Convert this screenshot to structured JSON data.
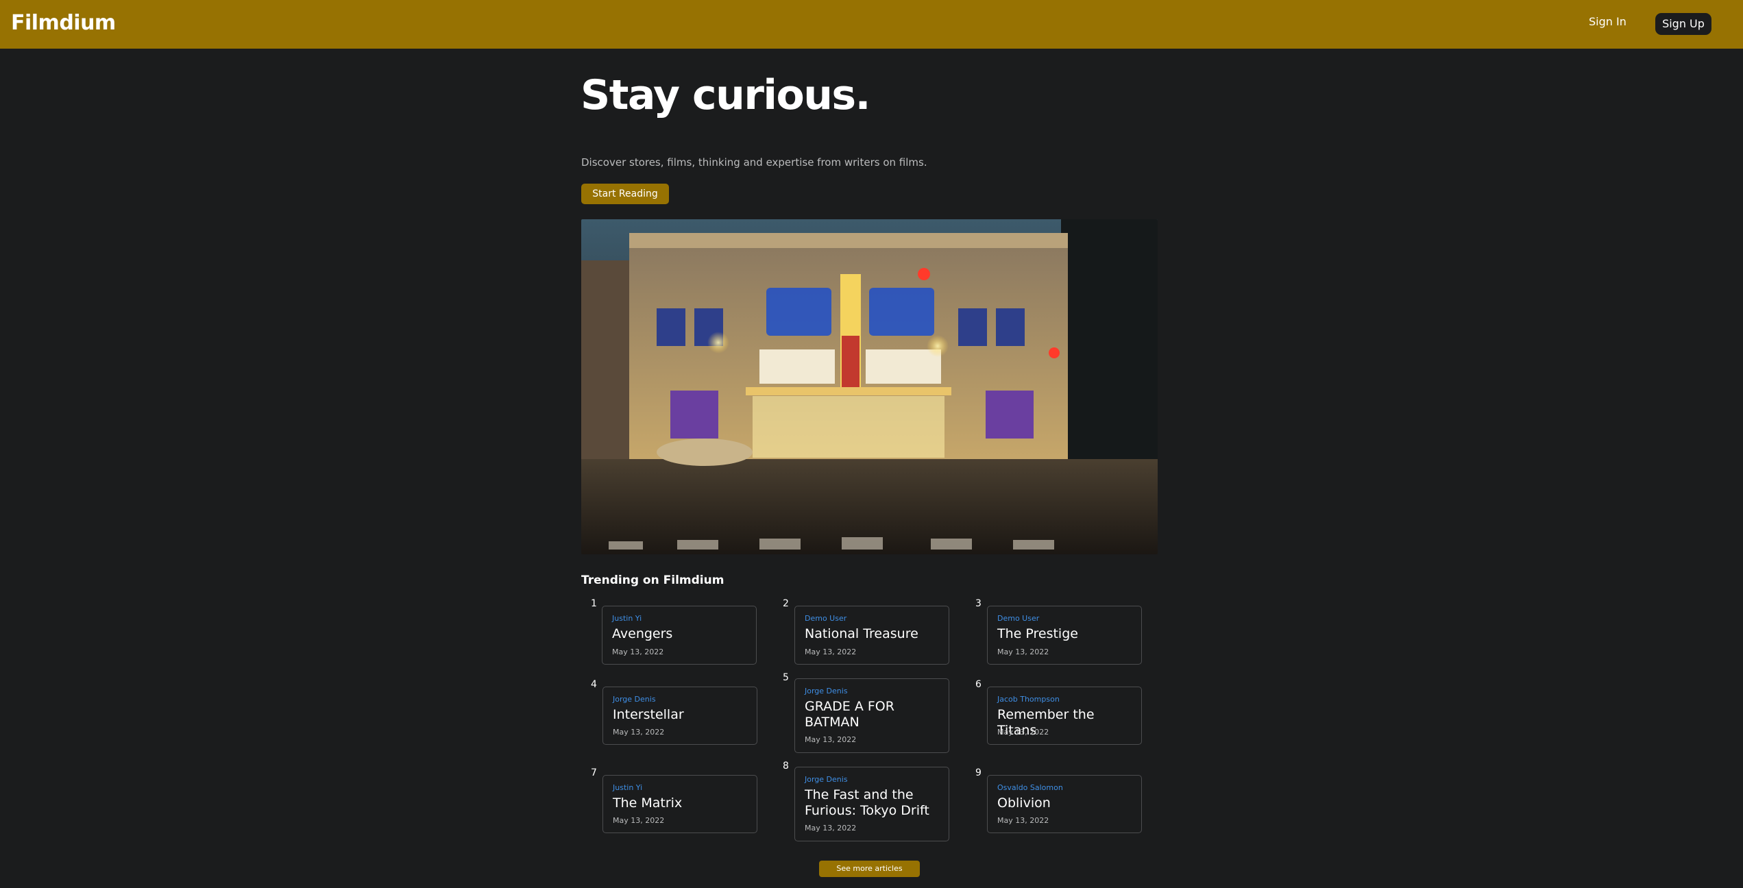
{
  "app": {
    "logo": "Filmdium",
    "sign_in": "Sign In",
    "sign_up": "Sign Up"
  },
  "hero": {
    "title": "Stay curious.",
    "subtitle": "Discover stores, films, thinking and expertise from writers on films.",
    "cta": "Start Reading",
    "image_alt": "Movie theater marquee at night"
  },
  "trending": {
    "heading": "Trending on Filmdium",
    "items": [
      {
        "rank": "1",
        "author": "Justin Yi",
        "title": "Avengers",
        "date": "May 13, 2022"
      },
      {
        "rank": "2",
        "author": "Demo User",
        "title": "National Treasure",
        "date": "May 13, 2022"
      },
      {
        "rank": "3",
        "author": "Demo User",
        "title": "The Prestige",
        "date": "May 13, 2022"
      },
      {
        "rank": "4",
        "author": "Jorge Denis",
        "title": "Interstellar",
        "date": "May 13, 2022"
      },
      {
        "rank": "5",
        "author": "Jorge Denis",
        "title": "GRADE A FOR BATMAN",
        "date": "May 13, 2022"
      },
      {
        "rank": "6",
        "author": "Jacob Thompson",
        "title": "Remember the Titans",
        "date": "May 13, 2022"
      },
      {
        "rank": "7",
        "author": "Justin Yi",
        "title": "The Matrix",
        "date": "May 13, 2022"
      },
      {
        "rank": "8",
        "author": "Jorge Denis",
        "title": "The Fast and the Furious: Tokyo Drift",
        "date": "May 13, 2022"
      },
      {
        "rank": "9",
        "author": "Osvaldo Salomon",
        "title": "Oblivion",
        "date": "May 13, 2022"
      }
    ],
    "see_more": "See more articles"
  },
  "colors": {
    "brand": "#977202",
    "background": "#1b1c1d",
    "author_link": "#3f8fe6"
  }
}
